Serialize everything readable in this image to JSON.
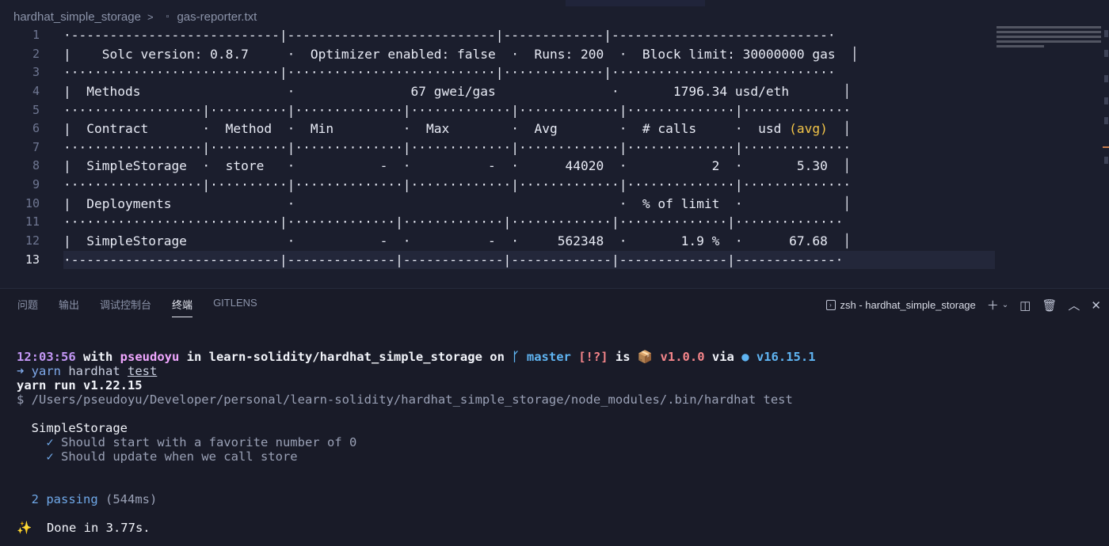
{
  "editor": {
    "breadcrumb": {
      "folder": "hardhat_simple_storage",
      "separator": ">",
      "file": "gas-reporter.txt"
    },
    "line_numbers": [
      "1",
      "2",
      "3",
      "4",
      "5",
      "6",
      "7",
      "8",
      "9",
      "10",
      "11",
      "12",
      "13"
    ],
    "current_line": "13",
    "lines": [
      "·---------------------------|---------------------------|-------------|----------------------------·",
      "|    Solc version: 0.8.7     ·  Optimizer enabled: false  ·  Runs: 200  ·  Block limit: 30000000 gas  │",
      "····························|···························|·············|·····························",
      "|  Methods                   ·               67 gwei/gas               ·       1796.34 usd/eth       │",
      "··················|··········|··············|·············|·············|··············|··············",
      "|  Contract       ·  Method  ·  Min         ·  Max        ·  Avg        ·  # calls     ·  usd ",
      "··················|··········|··············|·············|·············|··············|··············",
      "|  SimpleStorage  ·  store   ·           -  ·          -  ·      44020  ·           2  ·       5.30  │",
      "··················|··········|··············|·············|·············|··············|··············",
      "|  Deployments               ·                                          ·  % of limit  ·             │",
      "····························|··············|·············|·············|··············|··············",
      "|  SimpleStorage             ·           -  ·          -  ·     562348  ·       1.9 %  ·      67.68  │",
      "·---------------------------|--------------|-------------|-------------|--------------|-------------·"
    ],
    "line6_tail_highlight": "(avg)",
    "line6_tail_end": "  │"
  },
  "panel": {
    "tabs": [
      "问题",
      "输出",
      "调试控制台",
      "终端",
      "GITLENS"
    ],
    "active_tab": "终端",
    "terminal_name": "zsh - hardhat_simple_storage",
    "terminal_prompt_icon": "terminal-icon"
  },
  "terminal": {
    "time": "12:03:56",
    "with": " with ",
    "user": "pseudoyu",
    "in": " in ",
    "path": "learn-solidity/hardhat_simple_storage",
    "on": " on ",
    "branch_icon": "ᚴ",
    "branch": " master",
    "status": " [!?]",
    "is": " is ",
    "pkg_icon": "📦",
    "version": " v1.0.0",
    "via": " via ",
    "node_icon": "●",
    "node_version": " v16.15.1",
    "cmd_arrow": "➜",
    "cmd_yarn": " yarn",
    "cmd_rest": " hardhat ",
    "cmd_test": "test",
    "run_line": "yarn run v1.22.15",
    "exec_line": "$ /Users/pseudoyu/Developer/personal/learn-solidity/hardhat_simple_storage/node_modules/.bin/hardhat test",
    "suite": "  SimpleStorage",
    "tests": [
      {
        "mark": "    ✓",
        "name": " Should start with a favorite number of 0"
      },
      {
        "mark": "    ✓",
        "name": " Should update when we call store"
      }
    ],
    "passing_count": "  2 passing",
    "passing_time": " (544ms)",
    "done_icon": "✨",
    "done_text": "  Done in 3.77s."
  }
}
